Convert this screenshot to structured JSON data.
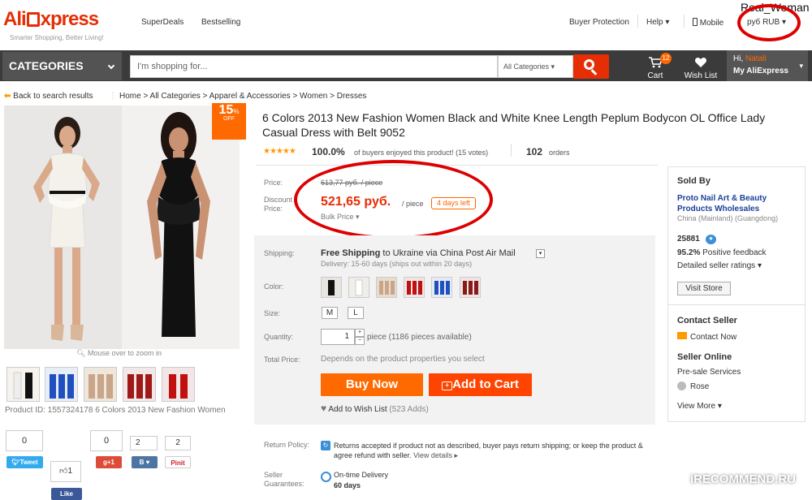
{
  "header": {
    "logo_ali": "Ali",
    "logo_rest": "xpress",
    "tagline": "Smarter Shopping, Better Living!",
    "links": [
      "SuperDeals",
      "Bestselling"
    ],
    "buyer_protection": "Buyer Protection",
    "help": "Help",
    "mobile": "Mobile",
    "currency": "руб RUB",
    "watermark_user": "Real_Woman"
  },
  "nav": {
    "categories": "CATEGORIES",
    "search_placeholder": "I'm shopping for...",
    "search_category": "All Categories",
    "cart_label": "Cart",
    "cart_count": "12",
    "wishlist_label": "Wish List",
    "greeting_hi": "Hi,",
    "greeting_name": "Natali",
    "my_aliexpress": "My AliExpress"
  },
  "breadcrumb": {
    "back": "Back to search results",
    "path": "Home > All Categories > Apparel & Accessories > Women > Dresses"
  },
  "gallery": {
    "discount_badge": "15",
    "discount_pct": "%",
    "discount_off": "OFF",
    "zoom_hint": "Mouse over to zoom in",
    "product_id_line": "Product ID: 1557324178 6 Colors 2013 New Fashion Women"
  },
  "product": {
    "title": "6 Colors 2013 New Fashion Women Black and White Knee Length Peplum Bodycon OL Office Lady Casual Dress with Belt 9052",
    "rating_pct": "100.0%",
    "rating_text": "of buyers enjoyed this product! (15 votes)",
    "orders_count": "102",
    "orders_label": "orders",
    "price_label": "Price:",
    "old_price": "613,77 руб. / piece",
    "discount_label_1": "Discount",
    "discount_label_2": "Price:",
    "new_price": "521,65 руб.",
    "per_piece": "/ piece",
    "days_left": "4 days left",
    "bulk_price": "Bulk Price",
    "shipping_label": "Shipping:",
    "shipping_free": "Free Shipping",
    "shipping_to": "to Ukraine via China Post Air Mail",
    "delivery": "Delivery: 15-60 days (ships out within 20 days)",
    "color_label": "Color:",
    "size_label": "Size:",
    "sizes": [
      "M",
      "L"
    ],
    "quantity_label": "Quantity:",
    "quantity_value": "1",
    "quantity_note": "piece (1186 pieces available)",
    "total_label": "Total Price:",
    "total_text": "Depends on the product properties you select",
    "buy_now": "Buy Now",
    "add_to_cart": "Add to Cart",
    "add_wishlist": "Add to Wish List",
    "wishlist_adds": "(523 Adds)",
    "return_label": "Return Policy:",
    "return_text": "Returns accepted if product not as described, buyer pays return shipping; or keep the product & agree refund with seller.",
    "view_details": "View details",
    "guarantee_label_1": "Seller",
    "guarantee_label_2": "Guarantees:",
    "ontime": "On-time Delivery",
    "ontime_days": "60 days"
  },
  "seller": {
    "sold_by": "Sold By",
    "store_name_1": "Proto Nail Art & Beauty",
    "store_name_2": "Products Wholesales",
    "location": "China (Mainland) (Guangdong)",
    "score": "25881",
    "feedback_pct": "95.2%",
    "feedback_label": "Positive feedback",
    "detailed": "Detailed seller ratings",
    "visit_store": "Visit Store",
    "contact_title": "Contact Seller",
    "contact_now": "Contact Now",
    "online_title": "Seller Online",
    "presale": "Pre-sale Services",
    "agent": "Rose",
    "view_more": "View More"
  },
  "social": {
    "tweet_count": "0",
    "tweet": "Tweet",
    "gplus_count": "0",
    "gplus": "+1",
    "vk_count": "2",
    "vk": "B",
    "pin_count": "2",
    "pin": "Pinit",
    "fb_count": "1",
    "fb": "Like"
  },
  "watermark": "iRECOMMEND.RU",
  "colors": {
    "brand": "#e62e04",
    "price": "#e62e04",
    "buy_btn": "#ff6a00",
    "cart_btn": "#ff4400",
    "link": "#1a3f9a",
    "annotation": "#dd0000"
  }
}
